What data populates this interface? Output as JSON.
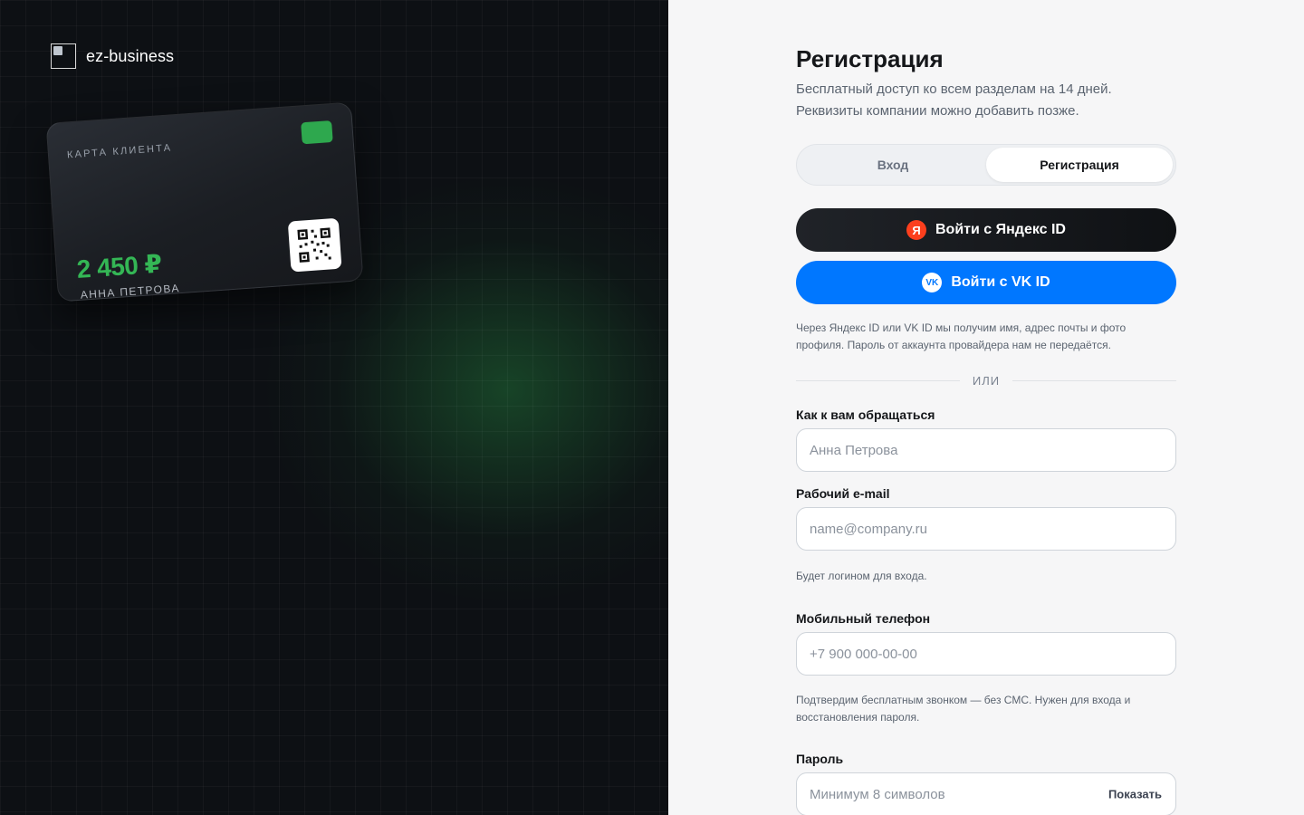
{
  "brand": {
    "name": "ez-business"
  },
  "card": {
    "label": "КАРТА КЛИЕНТА",
    "amount": "2 450 ₽",
    "holder": "АННА ПЕТРОВА",
    "chip_color": "#2ea84e"
  },
  "form": {
    "title": "Регистрация",
    "subtitle_line1": "Бесплатный доступ ко всем разделам на 14 дней.",
    "subtitle_line2": "Реквизиты компании можно добавить позже.",
    "tabs": [
      {
        "label": "Вход",
        "active": false
      },
      {
        "label": "Регистрация",
        "active": true
      }
    ],
    "yandex_button": {
      "label": "Войти с Яндекс ID",
      "icon": "yandex-icon",
      "icon_glyph": "Я",
      "color": "#fc3f1d"
    },
    "vk_button": {
      "label": "Войти с VK ID",
      "icon": "vk-icon",
      "icon_glyph": "VK",
      "color": "#0077ff"
    },
    "oauth_note": "Через Яндекс ID или VK ID мы получим имя, адрес почты и фото профиля. Пароль от аккаунта провайдера нам не передаётся.",
    "divider_text": "ИЛИ",
    "name_field": {
      "label": "Как к вам обращаться",
      "placeholder": "Анна Петрова",
      "value": ""
    },
    "email_field": {
      "label": "Рабочий e-mail",
      "placeholder": "name@company.ru",
      "value": "",
      "hint": "Будет логином для входа."
    },
    "phone_field": {
      "label": "Мобильный телефон",
      "placeholder": "+7 900 000-00-00",
      "value": "",
      "hint": "Подтвердим бесплатным звонком — без СМС. Нужен для входа и восстановления пароля."
    },
    "password_field": {
      "label": "Пароль",
      "placeholder": "Минимум 8 символов",
      "value": "",
      "toggle_label": "Показать"
    }
  }
}
